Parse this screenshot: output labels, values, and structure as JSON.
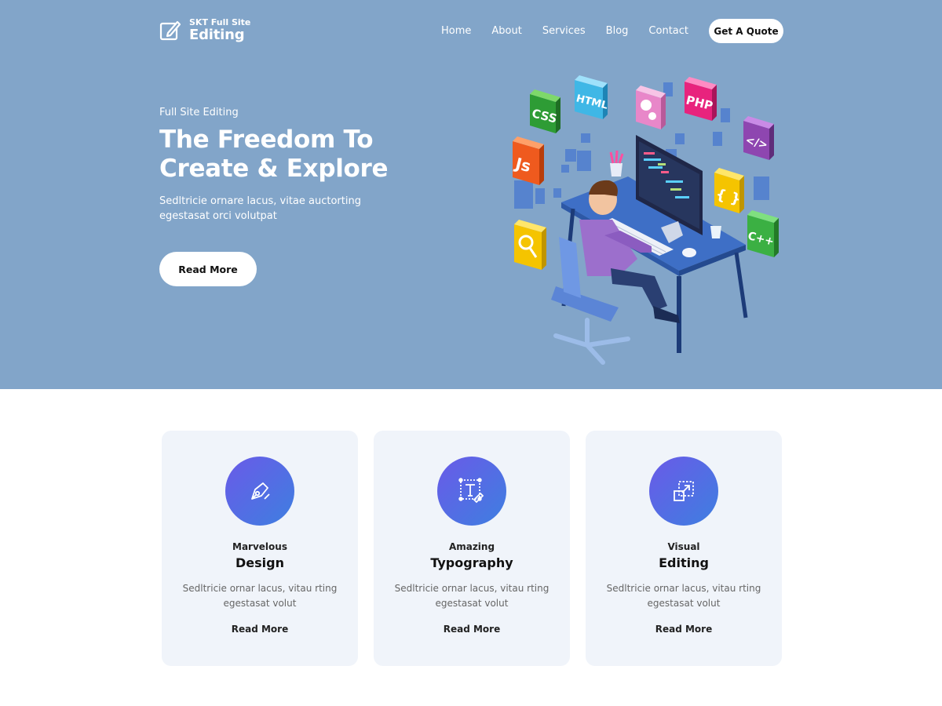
{
  "header": {
    "logo_small": "SKT Full Site",
    "logo_big": "Editing",
    "nav": [
      "Home",
      "About",
      "Services",
      "Blog",
      "Contact"
    ],
    "cta": "Get A Quote"
  },
  "hero": {
    "eyebrow": "Full Site Editing",
    "title": "The Freedom To Create & Explore",
    "description": "Sedltricie ornare lacus, vitae auctorting egestasat orci volutpat",
    "button": "Read More",
    "illustration_tiles": [
      "CSS",
      "HTML",
      "PHP",
      "Js",
      "{ }",
      "C++",
      "</>"
    ]
  },
  "features": [
    {
      "subtitle": "Marvelous",
      "title": "Design",
      "description": "Sedltricie ornar lacus, vitau rting egestasat volut",
      "link": "Read More",
      "icon": "pen-nib-icon"
    },
    {
      "subtitle": "Amazing",
      "title": "Typography",
      "description": "Sedltricie ornar lacus, vitau rting egestasat volut",
      "link": "Read More",
      "icon": "typography-icon"
    },
    {
      "subtitle": "Visual",
      "title": "Editing",
      "description": "Sedltricie ornar lacus, vitau rting egestasat volut",
      "link": "Read More",
      "icon": "resize-icon"
    }
  ],
  "colors": {
    "hero_bg": "#82a5c9",
    "card_bg": "#f0f4fa",
    "icon_gradient_start": "#6a5ae8",
    "icon_gradient_end": "#3e7fe0"
  }
}
